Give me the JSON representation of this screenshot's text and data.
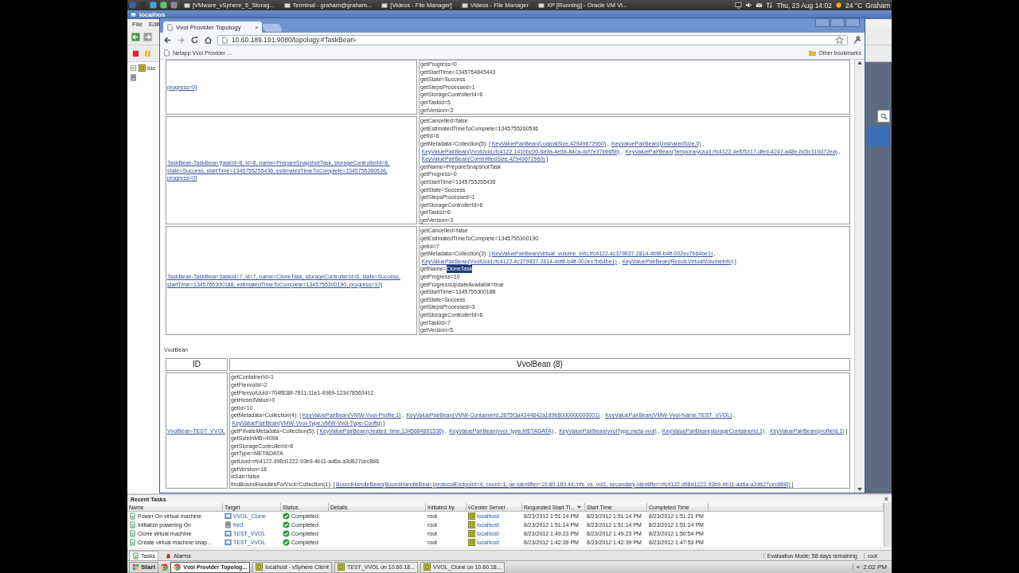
{
  "top_panel": {
    "windows": [
      "[VMware_vSphere_5_Storag...",
      "Terminal - graham@graham...",
      "[Videos - File Manager]",
      "Videos - File Manager",
      "XP [Running] - Oracle VM Vi..."
    ],
    "clock": "Thu, 23 Aug  14:02",
    "weather": "24 °C",
    "user": "Graham"
  },
  "vsphere": {
    "title": "localhos",
    "menu": [
      "File",
      "Edit"
    ],
    "tree_item": "loc"
  },
  "browser": {
    "tab": {
      "title": "Vvol Provider Topology",
      "close": "×"
    },
    "address": "10.60.189.191:9080/topology.#TaskBean-",
    "bookmarks": [
      "Netapp Vvol Provider ..."
    ],
    "other_bookmarks": "Other bookmarks",
    "task_rows": [
      {
        "bean": "progress=0]",
        "lines": [
          [
            "getProgress=0"
          ],
          [
            "getStartTime=1345754845443"
          ],
          [
            "getState=Success"
          ],
          [
            "getStepsProcessed=1"
          ],
          [
            "getStorageControllerId=6"
          ],
          [
            "getTaskId=5"
          ],
          [
            "getVersion=3"
          ]
        ]
      },
      {
        "bean": "TaskBean-TaskBean [taskId=6, id=6, name=PrepareSnapshotTask, storageControllerId=6, state=Success, startTime=1345755255436, estimatedTimeToComplete=1345755260536, progress=0]",
        "lines": [
          [
            "getCancelled=false"
          ],
          [
            "getEstimatedTimeToComplete=1345755260536"
          ],
          [
            "getId=6"
          ],
          [
            "getMetadata=Collection(5): [",
            {
              "kind": "link",
              "text": "KeyValuePairBean(LogicalSize,42949672960)"
            },
            ", ",
            {
              "kind": "link",
              "text": "KeyValuePairBean(UnsharedSize,0)"
            },
            ", ",
            {
              "kind": "link",
              "text": "KeyValuePairBean(VvolUuid,rfc4122.141bbc00-6a9a-4e58-84ca-dcf7e37bb65b)"
            },
            ", ",
            {
              "kind": "link",
              "text": "KeyValuePairBean(TemporaryUuid,rfc4122.4ef05317-dfed-4247-a48e-bc5c310d72ea)"
            },
            ", ",
            {
              "kind": "link",
              "text": "KeyValuePairBean(CommittedSize,42949672960)"
            },
            "]"
          ],
          [
            "getName=PrepareSnapshotTask"
          ],
          [
            "getProgress=0"
          ],
          [
            "getStartTime=1345755255436"
          ],
          [
            "getState=Success"
          ],
          [
            "getStepsProcessed=1"
          ],
          [
            "getStorageControllerId=6"
          ],
          [
            "getTaskId=6"
          ],
          [
            "getVersion=3"
          ]
        ]
      },
      {
        "bean": "TaskBean-TaskBean [taskId=7, id=7, name=CloneTask, storageControllerId=6, state=Success, startTime=1345755300188, estimatedTimeToComplete=1345755300190, progress=10]",
        "lines": [
          [
            "getCancelled=false"
          ],
          [
            "getEstimatedTimeToComplete=1345755300190"
          ],
          [
            "getId=7"
          ],
          [
            "getMetadata=Collection(3): [",
            {
              "kind": "link",
              "text": "KeyValuePairBean(virtual_volume_info,rfc4122.4c379837-2814-4bf8-b4ff-002ec7b64be1)"
            },
            ", ",
            {
              "kind": "link",
              "text": "KeyValuePairBean(VvolUuid,rfc4122.4c379837-2814-4bf8-b4ff-002ec7b64be1)"
            },
            ", ",
            {
              "kind": "link",
              "text": "KeyValuePairBean(Result,VirtualVolumeInfo)"
            },
            "]"
          ],
          [
            "getName=",
            {
              "kind": "selection",
              "text": "CloneTask"
            }
          ],
          [
            "getProgress=10"
          ],
          [
            "getProgressUpdateAvailable=true"
          ],
          [
            "getStartTime=1345755300188"
          ],
          [
            "getState=Success"
          ],
          [
            "getStepsProcessed=3"
          ],
          [
            "getStorageControllerId=6"
          ],
          [
            "getTaskId=7"
          ],
          [
            "getVersion=5"
          ]
        ]
      }
    ],
    "vvol_section": {
      "label": "VvolBean",
      "columns": [
        "ID",
        "VvolBean (8)"
      ],
      "rows": [
        {
          "bean": "VvolBean-TEST_VVOL",
          "lines": [
            [
              "getContainerId=1"
            ],
            [
              "getFlexvolId=2"
            ],
            [
              "getFlexvolUuid=704f838f-7811-11e1-8969-123478563412"
            ],
            [
              "getHosedValue=0"
            ],
            [
              "getId=10"
            ],
            [
              "getMetadata=Collection(4): [",
              {
                "kind": "link",
                "text": "KeyValuePairBean(VMW-Vvol-Profile,1)"
              },
              ", ",
              {
                "kind": "link",
                "text": "KeyValuePairBean(VMW-ContainerId,2875f3a4344842a189b8000000000001)"
              },
              ", ",
              {
                "kind": "link",
                "text": "KeyValuePairBean(VMW-Vvol-Name,TEST_VVOL)"
              },
              ", ",
              {
                "kind": "link",
                "text": "KeyValuePairBean(VMW-Vvol-Type,VMW-Vvol-Type-Config)"
              },
              "]"
            ],
            [
              "getPrivateMetadata=Collection(5): [",
              {
                "kind": "link",
                "text": "KeyValuePairBean(created_time,1345684891536)"
              },
              ", ",
              {
                "kind": "link",
                "text": "KeyValuePairBean(vvol_type,METADATA)"
              },
              ", ",
              {
                "kind": "link",
                "text": "KeyValuePairBean(vvolType,meta-vvol)"
              },
              ", ",
              {
                "kind": "link",
                "text": "KeyValuePairBean(storageContainerId,1)"
              },
              ", ",
              {
                "kind": "link",
                "text": "KeyValuePairBean(profileId,1)"
              },
              "]"
            ],
            [
              "getSizeInMB=4096"
            ],
            [
              "getStorageControllerId=6"
            ],
            [
              "getType=METADATA"
            ],
            [
              "getUuid=rfc4122.d98d1222-93b9-4b11-ad6a-a3d627cec866"
            ],
            [
              "getVersion=18"
            ],
            [
              "isSan=false"
            ],
            [
              "findBoundHandlesForVvol=Collection(1): [",
              {
                "kind": "link",
                "text": "BoundHandleBean(BoundHandleBean [protocolEndpoint=4, count=1, pe-identifier=10.60.189.44:/nfs_vs_vol1, secondary-identifier=rfc4122.d98d1222-93b9-4b11-ad6a-a3d627cec866])"
              },
              "]"
            ]
          ]
        }
      ]
    }
  },
  "recent_tasks": {
    "title": "Recent Tasks",
    "close": "×",
    "columns": [
      {
        "label": "Name",
        "sorted": false
      },
      {
        "label": "Target",
        "sorted": false
      },
      {
        "label": "Status",
        "sorted": false
      },
      {
        "label": "Details",
        "sorted": false
      },
      {
        "label": "Initiated by",
        "sorted": false
      },
      {
        "label": "vCenter Server",
        "sorted": false
      },
      {
        "label": "Requested Start Ti...",
        "sorted": true
      },
      {
        "label": "Start Time",
        "sorted": false
      },
      {
        "label": "Completed Time",
        "sorted": false
      }
    ],
    "rows": [
      {
        "name": "Power On virtual machine",
        "target": "VVOL_Clone",
        "kind": "vm",
        "status": "Completed",
        "initiated_by": "root",
        "server": "localhost",
        "requested": "8/23/2012 1:51:14 PM",
        "start": "8/23/2012 1:51:14 PM",
        "completed": "8/23/2012 1:51:21 PM"
      },
      {
        "name": "Initialize powering On",
        "target": "fred",
        "kind": "host",
        "status": "Completed",
        "initiated_by": "root",
        "server": "localhost",
        "requested": "8/23/2012 1:51:14 PM",
        "start": "8/23/2012 1:51:14 PM",
        "completed": "8/23/2012 1:51:14 PM"
      },
      {
        "name": "Clone virtual machine",
        "target": "TEST_VVOL",
        "kind": "vm",
        "status": "Completed",
        "initiated_by": "root",
        "server": "localhost",
        "requested": "8/23/2012 1:49:23 PM",
        "start": "8/23/2012 1:49:23 PM",
        "completed": "8/23/2012 1:50:54 PM"
      },
      {
        "name": "Create virtual machine snap...",
        "target": "TEST_VVOL",
        "kind": "vm",
        "status": "Completed",
        "initiated_by": "root",
        "server": "localhost",
        "requested": "8/23/2012 1:42:39 PM",
        "start": "8/23/2012 1:42:39 PM",
        "completed": "8/23/2012 1:47:53 PM"
      }
    ],
    "tabs": [
      {
        "label": "Tasks",
        "selected": true
      },
      {
        "label": "Alarms",
        "selected": false
      }
    ],
    "evaluation": "Evaluation Mode: 58 days remaining",
    "user": "root"
  },
  "taskbar": {
    "start": "Start",
    "items": [
      {
        "label": "Vvol Provider Topolog...",
        "selected": true
      },
      {
        "label": "localhost - vSphere Client",
        "selected": false
      },
      {
        "label": "TEST_VVOL on 10.60.18...",
        "selected": false
      },
      {
        "label": "VVOL_Clone on 10.60.18...",
        "selected": false
      }
    ],
    "chevron": "«",
    "time": "2:02 PM"
  }
}
